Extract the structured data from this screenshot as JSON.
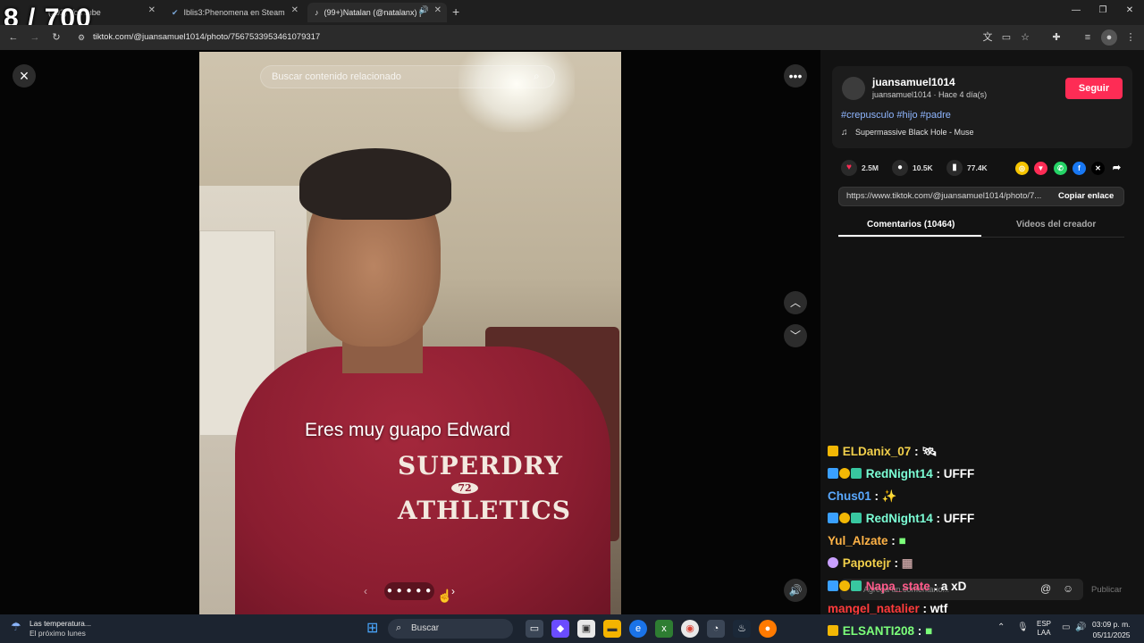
{
  "overlay": {
    "counter": "8 / 700"
  },
  "tabs": [
    {
      "label": "(292) YouTube"
    },
    {
      "label": "Iblis3:Phenomena en Steam"
    },
    {
      "label": "(99+)Natalan (@natalanx) |"
    }
  ],
  "address_bar": {
    "url": "tiktok.com/@juansamuel1014/photo/7567533953461079317"
  },
  "post": {
    "search_placeholder": "Buscar contenido relacionado",
    "caption": "Eres muy guapo Edward",
    "shirt_line1": "SUPERDRY",
    "shirt_number": "72",
    "shirt_line2": "ATHLETICS"
  },
  "author": {
    "username": "juansamuel1014",
    "meta": "juansamuel1014 · Hace 4 día(s)",
    "follow_label": "Seguir",
    "hashtags": "#crepusculo #hijo #padre",
    "music": "Supermassive Black Hole - Muse"
  },
  "stats": {
    "likes": "2.5M",
    "comments": "10.5K",
    "saves": "77.4K"
  },
  "share_link": {
    "url": "https://www.tiktok.com/@juansamuel1014/photo/7...",
    "copy_label": "Copiar enlace"
  },
  "panel_tabs": {
    "comments": "Comentarios (10464)",
    "creator": "Videos del creador"
  },
  "chat": [
    {
      "user": "ELDanix_07",
      "text": "",
      "color": "#f2d04b"
    },
    {
      "user": "RedNight14",
      "text": "UFFF",
      "color": "#7cffd6"
    },
    {
      "user": "Chus01",
      "text": "",
      "color": "#5aa9ff"
    },
    {
      "user": "RedNight14",
      "text": "UFFF",
      "color": "#7cffd6"
    },
    {
      "user": "Yul_Alzate",
      "text": "",
      "color": "#ffb347"
    },
    {
      "user": "Papotejr",
      "text": "",
      "color": "#f2d04b"
    },
    {
      "user": "Napa_state",
      "text": "a xD",
      "color": "#ff5a8a"
    },
    {
      "user": "mangel_natalier",
      "text": "wtf",
      "color": "#ff3b3b"
    },
    {
      "user": "ELSANTI208",
      "text": "",
      "color": "#7cff7a"
    }
  ],
  "comment_input": {
    "placeholder": "Agrega un comentario...",
    "publish_label": "Publicar"
  },
  "taskbar": {
    "weather": "Las temperatura...",
    "weather_sub": "El próximo lunes",
    "search": "Buscar",
    "lang1": "ESP",
    "lang2": "LAA",
    "time": "03:09 p. m.",
    "date": "05/11/2025"
  },
  "colors": {
    "accent": "#fe2c55",
    "hashtag": "#8fb6ff"
  }
}
